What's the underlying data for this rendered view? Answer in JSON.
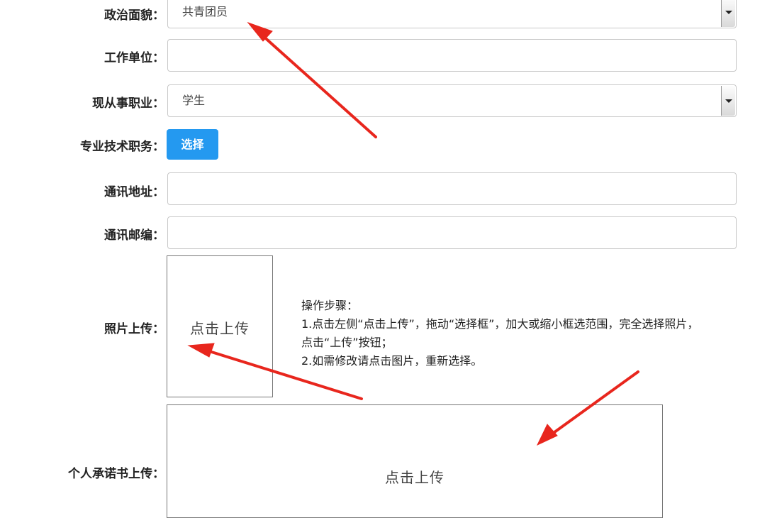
{
  "form": {
    "political_status": {
      "label": "政治面貌：",
      "value": "共青团员"
    },
    "work_unit": {
      "label": "工作单位：",
      "value": ""
    },
    "occupation": {
      "label": "现从事职业：",
      "value": "学生"
    },
    "professional_title": {
      "label": "专业技术职务：",
      "button_label": "选择"
    },
    "mailing_address": {
      "label": "通讯地址：",
      "value": ""
    },
    "postal_code": {
      "label": "通讯邮编：",
      "value": ""
    },
    "photo_upload": {
      "label": "照片上传：",
      "upload_text": "点击上传",
      "instructions": [
        "操作步骤：",
        "1.点击左侧“点击上传”，拖动“选择框”，加大或缩小框选范围，完全选择照片，",
        "点击“上传”按钮；",
        "2.如需修改请点击图片，重新选择。"
      ]
    },
    "commitment_upload": {
      "label": "个人承诺书上传：",
      "upload_text": "点击上传"
    }
  },
  "colors": {
    "button": "#2499f0",
    "annotation_arrow": "#e8261d"
  }
}
